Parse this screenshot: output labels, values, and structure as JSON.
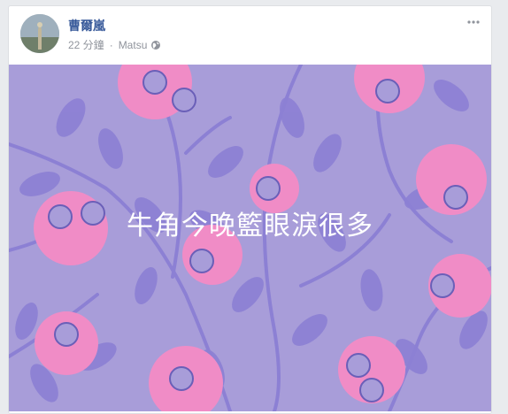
{
  "post": {
    "author_name": "曹爾嵐",
    "timestamp": "22 分鐘",
    "separator": "·",
    "location": "Matsu",
    "privacy_icon": "globe-icon",
    "more_icon": "more-options-icon",
    "text": "牛角今晚籃眼淚很多",
    "background_color": "#a89dd9",
    "flower_color": "#f08cc6",
    "leaf_color": "#8c80d4"
  }
}
